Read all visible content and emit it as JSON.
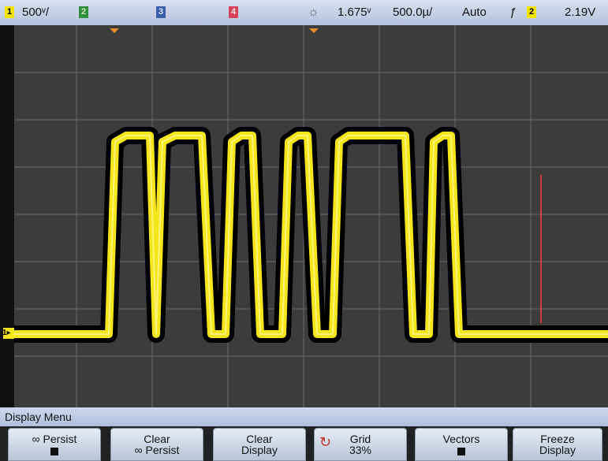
{
  "topbar": {
    "ch1_label": "1",
    "ch1_scale": "500ᵛ/",
    "ch2_label": "2",
    "ch3_label": "3",
    "ch4_label": "4",
    "trigger_level": "1.675ᵛ",
    "time_scale": "500.0µ/",
    "mode": "Auto",
    "slope_symbol": "ƒ",
    "trigger_source": "2",
    "trigger_voltage": "2.19V",
    "brightness_icon": "sun-icon"
  },
  "screen": {
    "ch1_marker": "1▸",
    "colors": {
      "background": "#3c3c3c",
      "grid": "#6a6a6a",
      "trace": "#f4e61a",
      "persist": "#000000",
      "marker": "#ff3b3b"
    }
  },
  "menu": {
    "title": "Display Menu",
    "softkeys": [
      {
        "line1": "∞ Persist",
        "line2": "",
        "has_box": true
      },
      {
        "line1": "Clear",
        "line2": "∞ Persist",
        "has_box": false
      },
      {
        "line1": "Clear",
        "line2": "Display",
        "has_box": false
      },
      {
        "line1": "Grid",
        "line2": "33%",
        "has_box": false,
        "icon": "knob-icon"
      },
      {
        "line1": "Vectors",
        "line2": "",
        "has_box": true
      },
      {
        "line1": "Freeze",
        "line2": "Display",
        "has_box": false
      }
    ]
  }
}
